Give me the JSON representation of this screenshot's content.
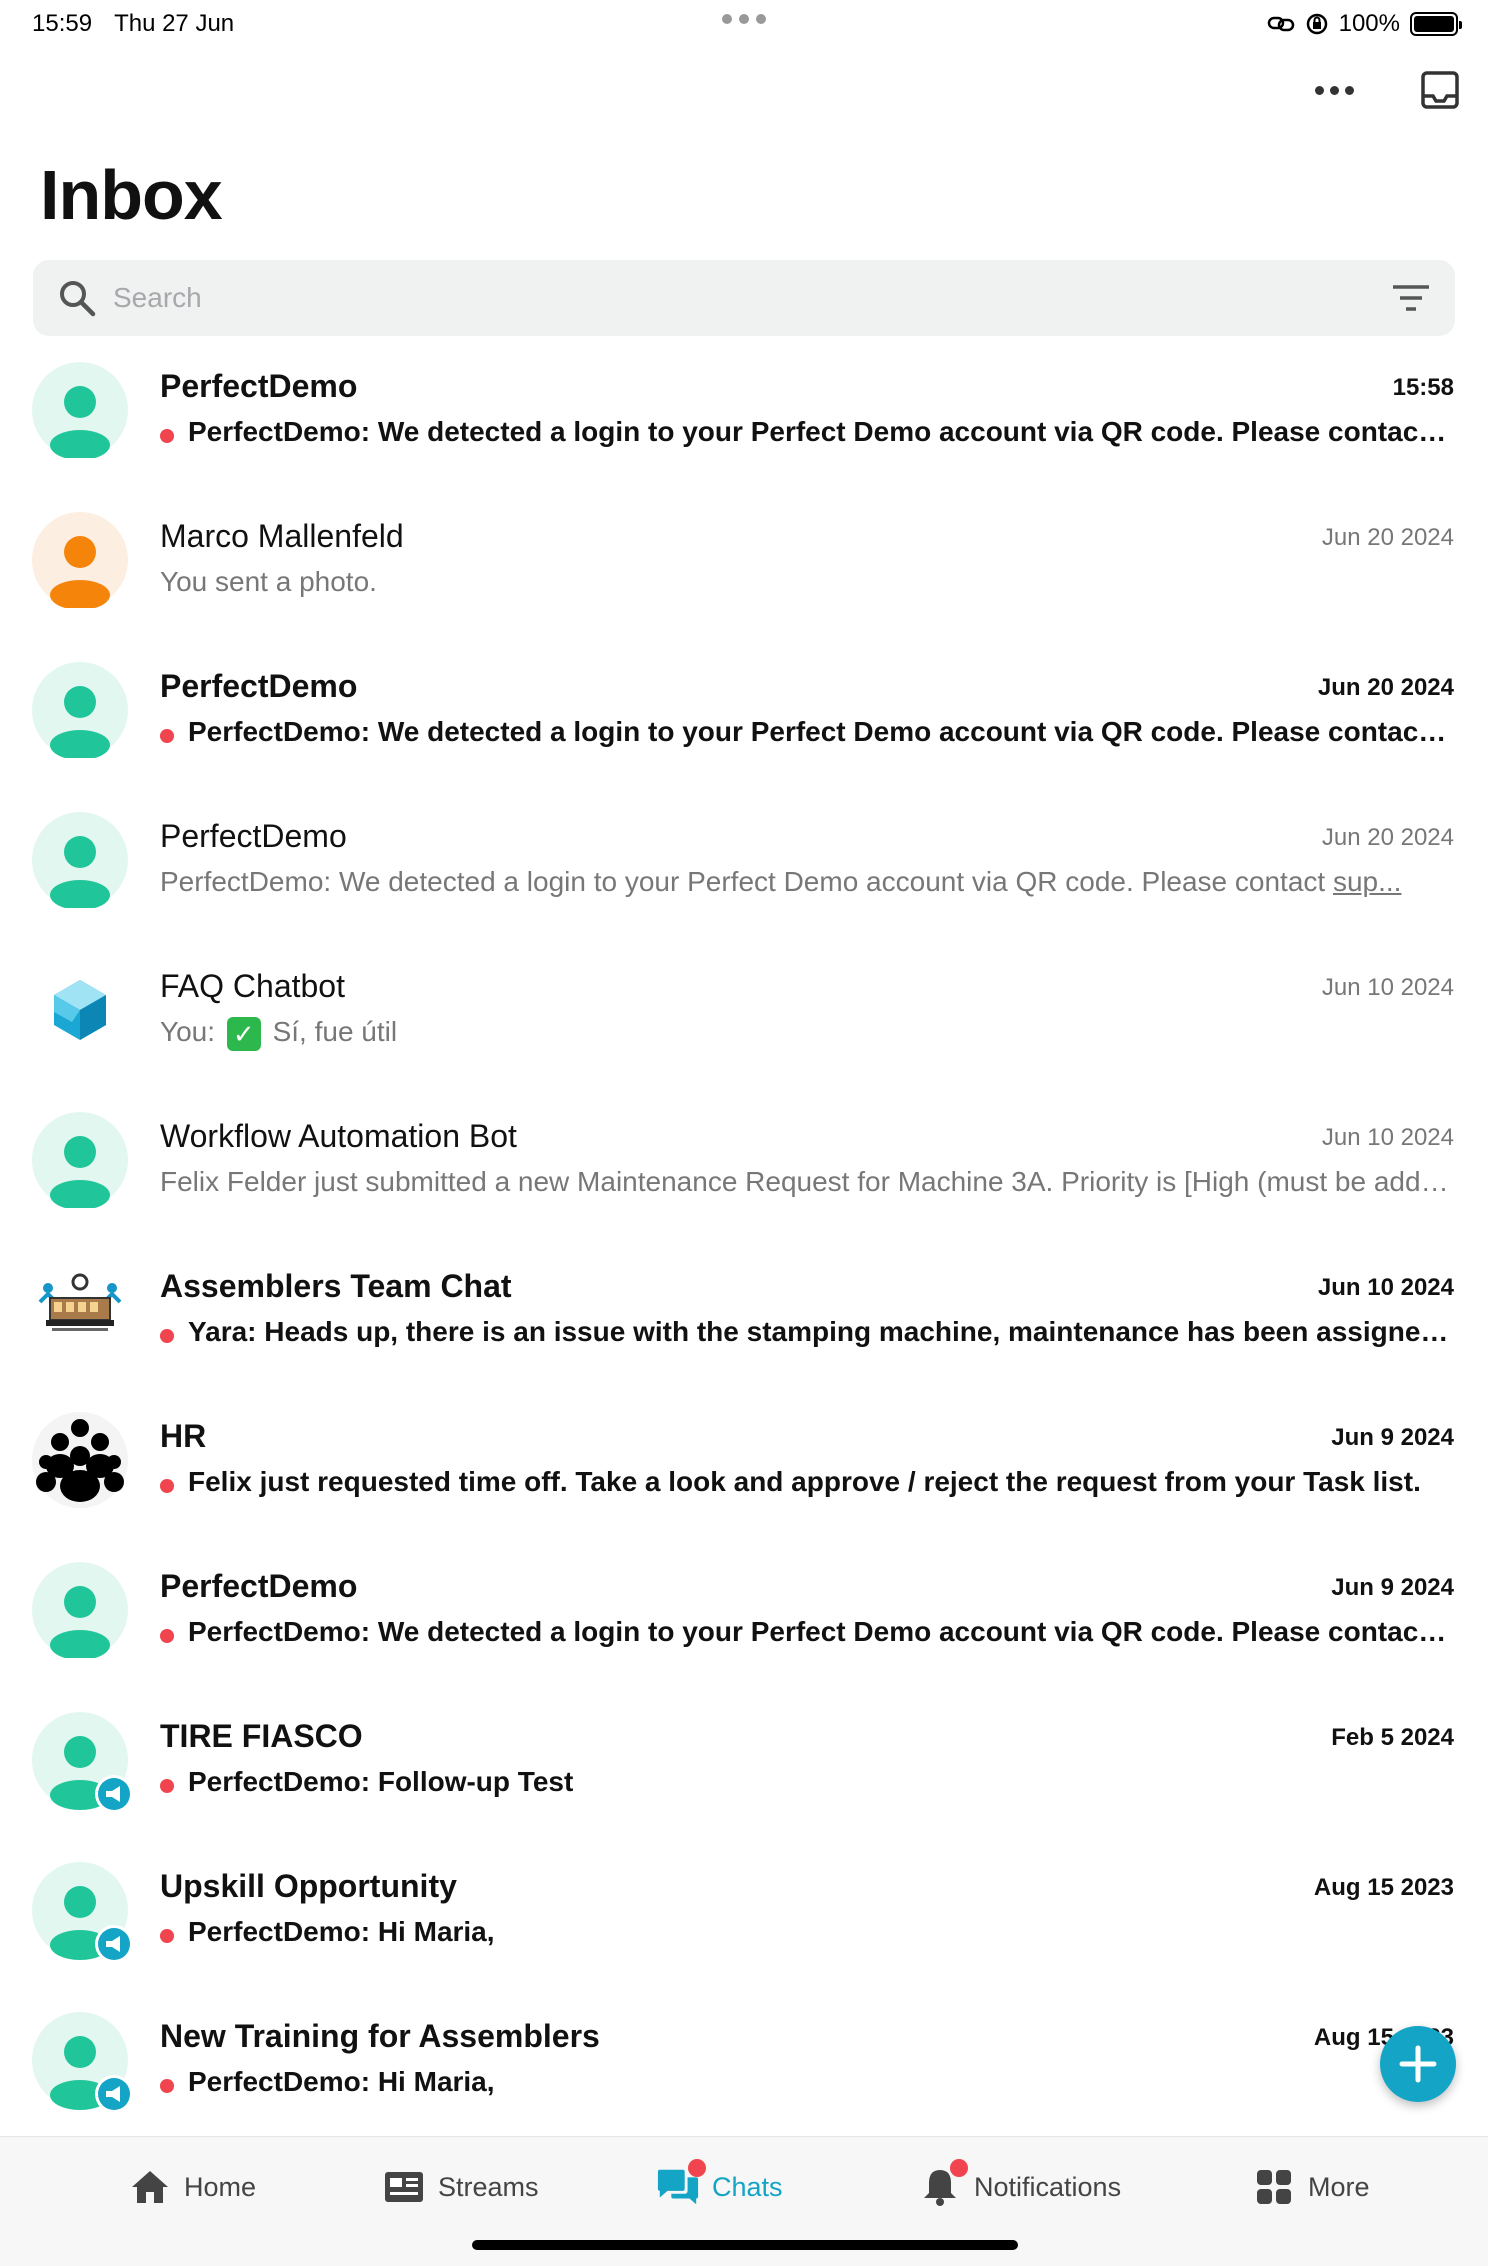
{
  "status_bar": {
    "time": "15:59",
    "date": "Thu 27 Jun",
    "battery": "100%"
  },
  "header": {
    "title": "Inbox"
  },
  "search": {
    "placeholder": "Search"
  },
  "colors": {
    "accent": "#13a4c6",
    "unread_dot": "#f0454e",
    "avatar_green": "#20c69a",
    "avatar_orange": "#f5850a"
  },
  "chats": [
    {
      "name": "PerfectDemo",
      "time": "15:58",
      "preview": "PerfectDemo: We detected a login to your Perfect Demo account via QR code. Please contact support if this was not you.",
      "unread": true,
      "avatar": "person-green-icon"
    },
    {
      "name": "Marco Mallenfeld",
      "time": "Jun 20 2024",
      "preview": "You sent a photo.",
      "unread": false,
      "avatar": "person-orange-icon"
    },
    {
      "name": "PerfectDemo",
      "time": "Jun 20 2024",
      "preview": "PerfectDemo: We detected a login to your Perfect Demo account via QR code. Please contact support if this was not you.",
      "unread": true,
      "avatar": "person-green-icon"
    },
    {
      "name": "PerfectDemo",
      "time": "Jun 20 2024",
      "preview_prefix": "PerfectDemo: We detected a login to your Perfect Demo account via QR code. Please contact ",
      "preview_link": "sup...",
      "unread": false,
      "avatar": "person-green-icon"
    },
    {
      "name": "FAQ Chatbot",
      "time": "Jun 10 2024",
      "preview_prefix": "You: ",
      "preview_emoji": "✓",
      "preview_suffix": " Sí, fue útil",
      "unread": false,
      "avatar": "cube-bot-icon"
    },
    {
      "name": "Workflow Automation Bot",
      "time": "Jun 10 2024",
      "preview": "Felix Felder just submitted a new Maintenance Request for Machine 3A. Priority is [High (must be addressed immediately)]",
      "unread": false,
      "avatar": "person-green-icon"
    },
    {
      "name": "Assemblers Team Chat",
      "time": "Jun 10 2024",
      "preview": "Yara: Heads up, there is an issue with the stamping machine, maintenance has been assigned to it.",
      "unread": true,
      "avatar": "team-image-icon"
    },
    {
      "name": "HR",
      "time": "Jun 9 2024",
      "preview": "Felix just requested time off. Take a look and approve / reject the request from your Task list.",
      "unread": true,
      "avatar": "group-people-icon"
    },
    {
      "name": "PerfectDemo",
      "time": "Jun 9 2024",
      "preview": "PerfectDemo: We detected a login to your Perfect Demo account via QR code. Please contact support if this was not you.",
      "unread": true,
      "avatar": "person-green-icon"
    },
    {
      "name": "TIRE FIASCO",
      "time": "Feb 5 2024",
      "preview": "PerfectDemo: Follow-up Test",
      "unread": true,
      "avatar": "person-green-stream-icon"
    },
    {
      "name": "Upskill Opportunity",
      "time": "Aug 15 2023",
      "preview": "PerfectDemo: Hi Maria,",
      "unread": true,
      "avatar": "person-green-stream-icon"
    },
    {
      "name": "New Training for Assemblers",
      "time": "Aug 15 2023",
      "preview": "PerfectDemo: Hi Maria,",
      "unread": true,
      "avatar": "person-green-stream-icon"
    }
  ],
  "tabs": [
    {
      "label": "Home",
      "icon": "home-icon"
    },
    {
      "label": "Streams",
      "icon": "streams-icon"
    },
    {
      "label": "Chats",
      "icon": "chats-icon",
      "active": true,
      "badge": true
    },
    {
      "label": "Notifications",
      "icon": "bell-icon",
      "badge": true
    },
    {
      "label": "More",
      "icon": "grid-icon"
    }
  ]
}
